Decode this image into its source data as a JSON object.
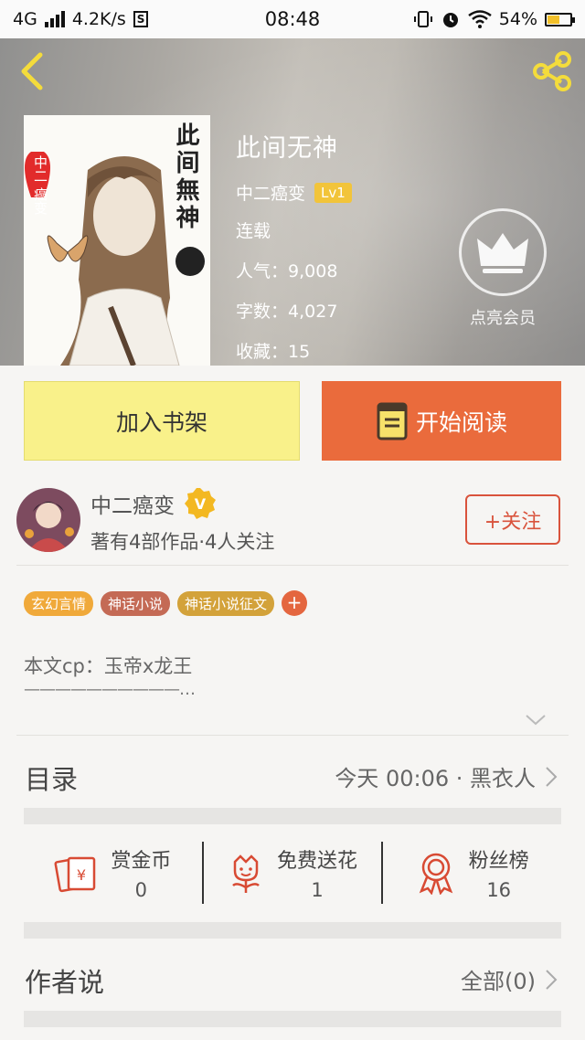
{
  "status_bar": {
    "network": "4G",
    "speed": "4.2K/s",
    "time": "08:48",
    "battery": "54%"
  },
  "book": {
    "title": "此间无神",
    "author": "中二癌变",
    "level": "Lv1",
    "status": "连载",
    "popularity_label": "人气：",
    "popularity": "9,008",
    "word_count_label": "字数：",
    "word_count": "4,027",
    "favorites_label": "收藏：",
    "favorites": "15",
    "cover_title_text": "此间無神",
    "cover_author_text": "中二 癌变"
  },
  "vip": {
    "label": "点亮会员"
  },
  "actions": {
    "add_shelf": "加入书架",
    "start_reading": "开始阅读"
  },
  "author_card": {
    "name": "中二癌变",
    "badge": "V",
    "meta": "著有4部作品·4人关注",
    "follow": "+关注"
  },
  "tags": [
    {
      "label": "玄幻言情",
      "color": "#f0a93a"
    },
    {
      "label": "神话小说",
      "color": "#c46a55"
    },
    {
      "label": "神话小说征文",
      "color": "#d3a23a"
    }
  ],
  "tag_add": "+",
  "synopsis": {
    "text": "本文cp：玉帝x龙王",
    "line": "——————————…"
  },
  "catalog": {
    "title": "目录",
    "latest": "今天 00:06 · 黑衣人"
  },
  "stats": [
    {
      "label": "赏金币",
      "value": "0",
      "icon": "reward-coin-icon"
    },
    {
      "label": "免费送花",
      "value": "1",
      "icon": "flower-icon"
    },
    {
      "label": "粉丝榜",
      "value": "16",
      "icon": "fan-ranking-medal-icon"
    }
  ],
  "author_say": {
    "title": "作者说",
    "all": "全部(0)"
  },
  "colors": {
    "accent_orange": "#ea6b3c",
    "shelf_yellow": "#f9f18a",
    "follow_red": "#d9533c",
    "level_badge": "#f2c43a"
  }
}
